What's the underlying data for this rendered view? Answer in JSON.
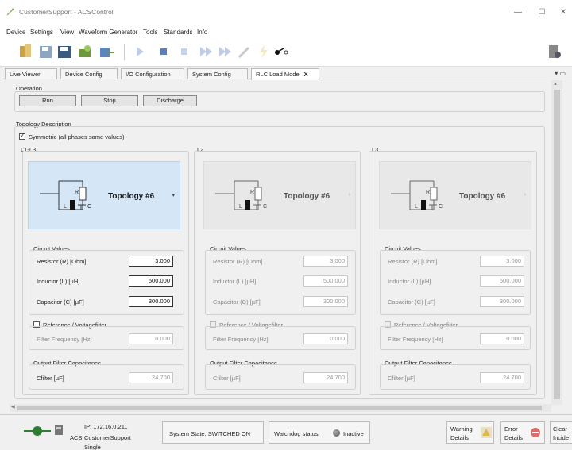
{
  "window": {
    "title": "CustomerSupport - ACSControl"
  },
  "menu": [
    "Device",
    "Settings",
    "View",
    "Waveform Generator",
    "Tools",
    "Standards",
    "Info"
  ],
  "tabs": [
    {
      "label": "Live Viewer"
    },
    {
      "label": "Device Config"
    },
    {
      "label": "I/O Configuration"
    },
    {
      "label": "System Config"
    },
    {
      "label": "RLC Load Mode",
      "close": "X"
    }
  ],
  "operation": {
    "label": "Operation",
    "run": "Run",
    "stop": "Stop",
    "discharge": "Discharge"
  },
  "topology": {
    "label": "Topology Description",
    "symmetric": "Symmetric (all phases same values)",
    "symmetric_checked": true
  },
  "phases": [
    {
      "label": "L1-L3",
      "active": true,
      "topology": "Topology #6",
      "circuit_label": "Circuit Values",
      "resistor_label": "Resistor (R) [Ohm]",
      "resistor": "3.000",
      "inductor_label": "Inductor (L) [µH]",
      "inductor": "500.000",
      "capacitor_label": "Capacitor (C) [µF]",
      "capacitor": "300.000",
      "ref_label": "Reference / Voltagefilter",
      "filter_freq_label": "Filter Frequency [Hz]",
      "filter_freq": "0.000",
      "output_label": "Output Filter Capacitance",
      "cfilter_label": "Cfilter [µF]",
      "cfilter": "24.700"
    },
    {
      "label": "L2",
      "active": false,
      "topology": "Topology #6",
      "circuit_label": "Circuit Values",
      "resistor_label": "Resistor (R) [Ohm]",
      "resistor": "3.000",
      "inductor_label": "Inductor (L) [µH]",
      "inductor": "500.000",
      "capacitor_label": "Capacitor (C) [µF]",
      "capacitor": "300.000",
      "ref_label": "Reference / Voltagefilter",
      "filter_freq_label": "Filter Frequency [Hz]",
      "filter_freq": "0.000",
      "output_label": "Output Filter Capacitance",
      "cfilter_label": "Cfilter [µF]",
      "cfilter": "24.700"
    },
    {
      "label": "L3",
      "active": false,
      "topology": "Topology #6",
      "circuit_label": "Circuit Values",
      "resistor_label": "Resistor (R) [Ohm]",
      "resistor": "3.000",
      "inductor_label": "Inductor (L) [µH]",
      "inductor": "500.000",
      "capacitor_label": "Capacitor (C) [µF]",
      "capacitor": "300.000",
      "ref_label": "Reference / Voltagefilter",
      "filter_freq_label": "Filter Frequency [Hz]",
      "filter_freq": "0.000",
      "output_label": "Output Filter Capacitance",
      "cfilter_label": "Cfilter [µF]",
      "cfilter": "24.700"
    }
  ],
  "status": {
    "acs": "ACS",
    "ip": "IP: 172.16.0.211",
    "device": "CustomerSupport",
    "mode": "Single",
    "system_state": "System State: SWITCHED ON",
    "watchdog": "Watchdog status:",
    "watchdog_value": "Inactive",
    "warning": "Warning",
    "warning_details": "Details",
    "error": "Error",
    "error_details": "Details",
    "clear": "Clear",
    "clear2": "Incide"
  },
  "colors": {
    "active_card": "#d5e6f7",
    "dim_card": "#e8e8e8"
  }
}
